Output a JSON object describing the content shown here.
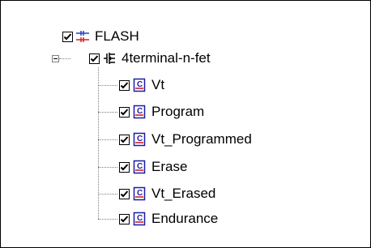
{
  "tree": {
    "root": {
      "label": "FLASH",
      "checked": true,
      "icon": "circuit-icon"
    },
    "device": {
      "label": "4terminal-n-fet",
      "checked": true,
      "expanded": true,
      "icon": "transistor-icon"
    },
    "children": [
      {
        "label": "Vt",
        "checked": true,
        "icon": "document-c-icon"
      },
      {
        "label": "Program",
        "checked": true,
        "icon": "document-c-icon"
      },
      {
        "label": "Vt_Programmed",
        "checked": true,
        "icon": "document-c-icon"
      },
      {
        "label": "Erase",
        "checked": true,
        "icon": "document-c-icon"
      },
      {
        "label": "Vt_Erased",
        "checked": true,
        "icon": "document-c-icon"
      },
      {
        "label": "Endurance",
        "checked": true,
        "icon": "document-c-icon"
      }
    ]
  },
  "colors": {
    "doc_blue": "#1a1aa8",
    "doc_red": "#d01010",
    "circuit_blue": "#2040c0",
    "circuit_red": "#d02020"
  }
}
